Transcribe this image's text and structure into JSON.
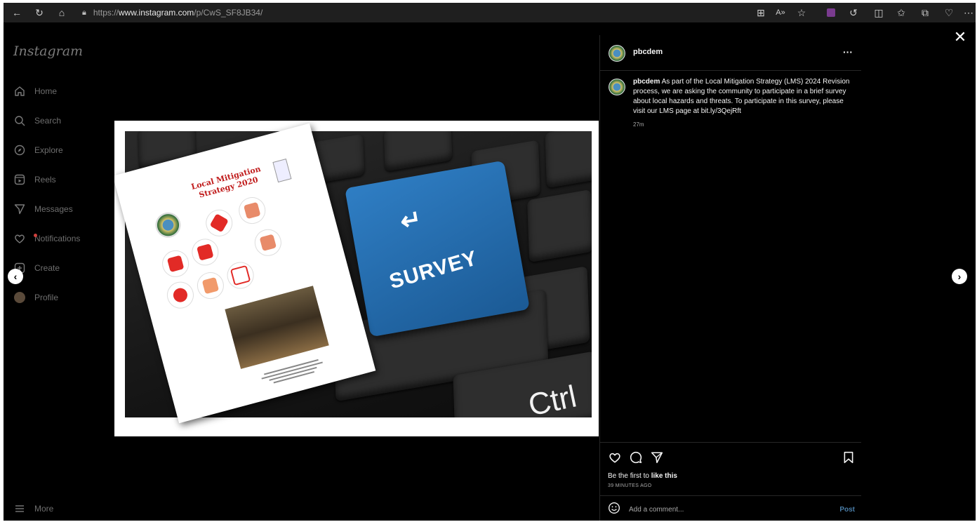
{
  "browser": {
    "url_prefix": "https://",
    "url_host": "www.instagram.com",
    "url_path": "/p/CwS_SF8JB34/"
  },
  "sidebar": {
    "logo": "Instagram",
    "items": [
      {
        "label": "Home",
        "icon": "home-icon"
      },
      {
        "label": "Search",
        "icon": "search-icon"
      },
      {
        "label": "Explore",
        "icon": "compass-icon"
      },
      {
        "label": "Reels",
        "icon": "reels-icon"
      },
      {
        "label": "Messages",
        "icon": "send-icon"
      },
      {
        "label": "Notifications",
        "icon": "heart-icon"
      },
      {
        "label": "Create",
        "icon": "plus-square-icon"
      },
      {
        "label": "Profile",
        "icon": "avatar"
      }
    ],
    "more_label": "More"
  },
  "media": {
    "doc_title": "Local Mitigation Strategy 2020",
    "survey_label": "SURVEY",
    "ctrl_label": "Ctrl"
  },
  "post": {
    "username": "pbcdem",
    "caption_user": "pbcdem",
    "caption_text": "As part of the Local Mitigation Strategy (LMS) 2024 Revision process, we are asking the community to participate in a brief survey about local hazards and threats. To participate in this survey, please visit our LMS page at bit.ly/3QejRft",
    "relative_time": "27m",
    "likes_prefix": "Be the first to ",
    "likes_action": "like this",
    "timestamp": "39 MINUTES AGO",
    "comment_placeholder": "Add a comment...",
    "post_label": "Post"
  },
  "colors": {
    "background": "#000000",
    "post_button": "#4a7ea8",
    "survey_key": "#2f7ec4"
  }
}
